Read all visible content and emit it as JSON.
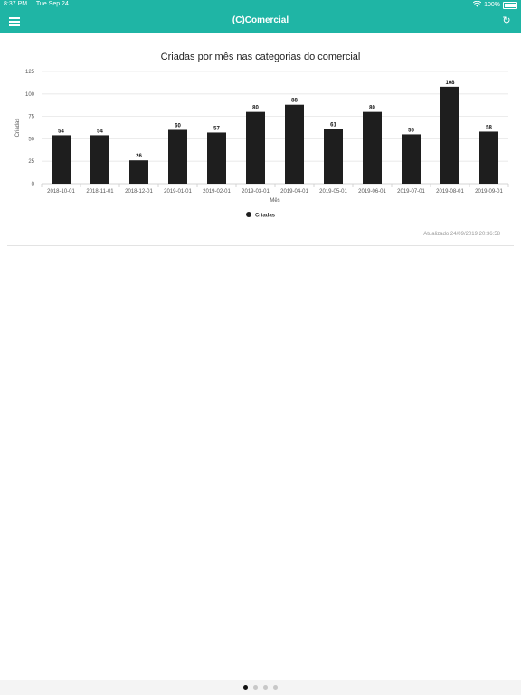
{
  "status_bar": {
    "time": "8:37 PM",
    "date": "Tue Sep 24",
    "wifi_icon": "wifi-icon",
    "battery": "100%"
  },
  "app_bar": {
    "title": "(C)Comercial",
    "menu_icon": "hamburger-menu-icon",
    "refresh_icon": "refresh-icon"
  },
  "chart_data": {
    "type": "bar",
    "title": "Criadas por mês nas categorias do comercial",
    "xlabel": "Mês",
    "ylabel": "Criadas",
    "categories": [
      "2018-10-01",
      "2018-11-01",
      "2018-12-01",
      "2019-01-01",
      "2019-02-01",
      "2019-03-01",
      "2019-04-01",
      "2019-05-01",
      "2019-06-01",
      "2019-07-01",
      "2019-08-01",
      "2019-09-01"
    ],
    "series": [
      {
        "name": "Criadas",
        "values": [
          54,
          54,
          26,
          60,
          57,
          80,
          88,
          61,
          80,
          55,
          108,
          58
        ],
        "color": "#1e1e1e"
      }
    ],
    "ylim": [
      0,
      125
    ],
    "yticks": [
      0,
      25,
      50,
      75,
      100,
      125
    ],
    "grid": true,
    "legend": "bottom-center"
  },
  "footer": {
    "updated": "Atualizado 24/09/2019 20:36:58"
  },
  "pager": {
    "count": 4,
    "active": 0
  }
}
